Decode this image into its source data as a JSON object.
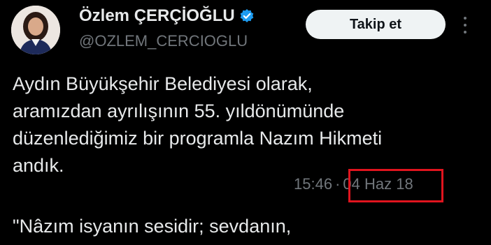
{
  "header": {
    "display_name": "Özlem ÇERÇİOĞLU",
    "handle": "@OZLEM_CERCIOGLU",
    "follow_label": "Takip et",
    "verified_color": "#1d9bf0"
  },
  "tweet": {
    "lines": [
      "Aydın Büyükşehir Belediyesi olarak,",
      "aramızdan ayrılışının 55. yıldönümünde",
      "düzenlediğimiz bir programla Nazım Hikmeti",
      "andık."
    ],
    "time": "15:46",
    "date": "04 Haz 18",
    "separator": "·",
    "quote_start": "\"Nâzım isyanın sesidir; sevdanın,"
  },
  "colors": {
    "background": "#000000",
    "text": "#e7e9ea",
    "secondary": "#71767b",
    "highlight_box": "#e0141e"
  }
}
